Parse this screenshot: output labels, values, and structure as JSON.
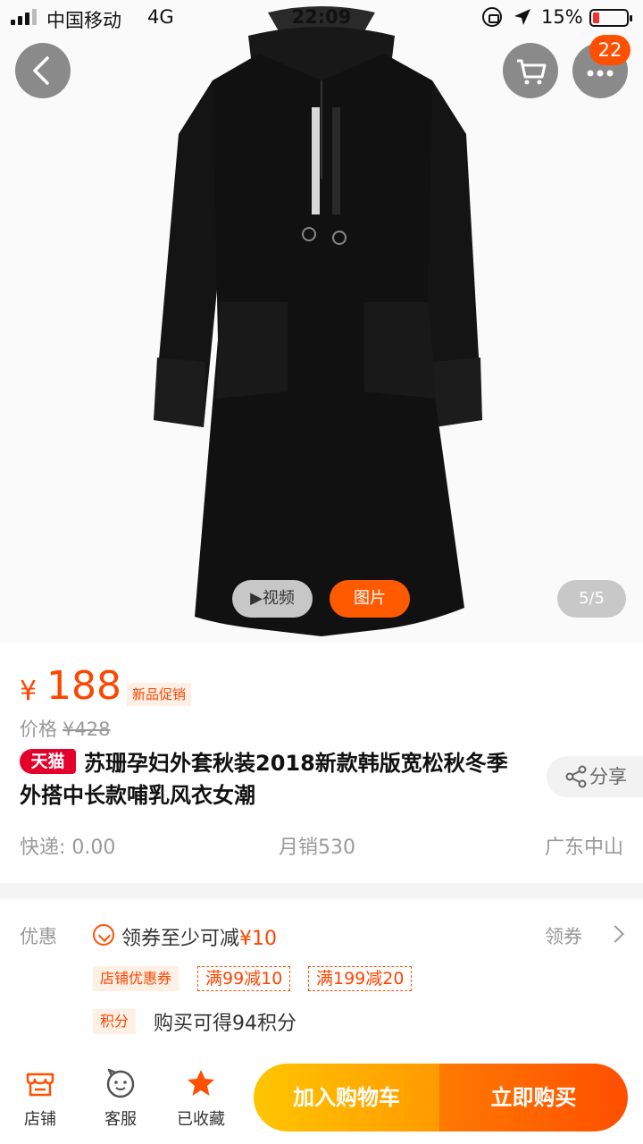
{
  "status_bar": {
    "carrier": "中国移动",
    "network": "4G",
    "time": "22:09",
    "battery": "15%"
  },
  "nav": {
    "cart_icon": "cart-icon",
    "more_icon": "more-icon",
    "badge_count": "22"
  },
  "media": {
    "video_label": "▶视频",
    "photo_label": "图片",
    "page_indicator": "5/5"
  },
  "product": {
    "price_symbol": "¥",
    "price": "188",
    "promo_tag": "新品促销",
    "original_price_label": "价格",
    "original_price": "¥428",
    "store_tag": "天猫",
    "title": "苏珊孕妇外套秋装2018新款韩版宽松秋冬季外搭中长款哺乳风衣女潮",
    "share_label": "分享",
    "shipping": "快递: 0.00",
    "monthly_sales": "月销530",
    "location": "广东中山"
  },
  "coupons": {
    "section_label": "优惠",
    "coupon_text": "领券至少可减",
    "coupon_amount": "¥10",
    "get_label": "领券",
    "store_coupon_tag": "店铺优惠券",
    "tickets": [
      "满99减10",
      "满199减20"
    ],
    "points_tag": "积分",
    "points_text": "购买可得94积分"
  },
  "bottom_bar": {
    "tabs": [
      {
        "label": "店铺",
        "icon": "store-icon"
      },
      {
        "label": "客服",
        "icon": "service-icon"
      },
      {
        "label": "已收藏",
        "icon": "star-icon"
      }
    ],
    "add_to_cart": "加入购物车",
    "buy_now": "立即购买"
  },
  "colors": {
    "accent": "#ff5000",
    "price": "#ff4400",
    "tmall": "#e4002b",
    "cart_gradient": [
      "#ffc500",
      "#ff9a00"
    ],
    "buy_gradient": [
      "#ff7a00",
      "#ff4f00"
    ]
  }
}
